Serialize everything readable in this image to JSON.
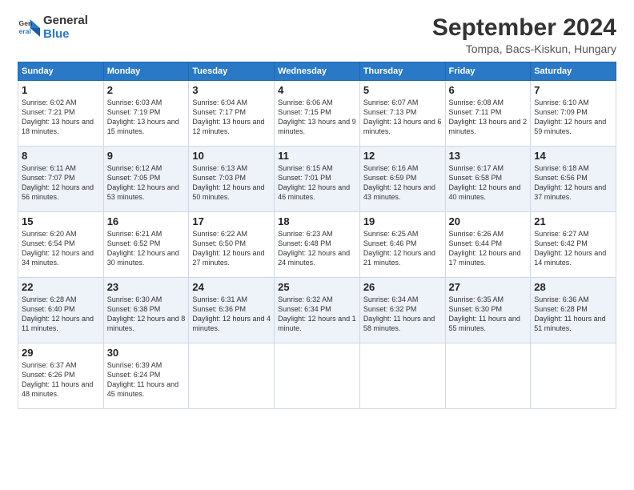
{
  "logo": {
    "line1": "General",
    "line2": "Blue"
  },
  "title": "September 2024",
  "subtitle": "Tompa, Bacs-Kiskun, Hungary",
  "headers": [
    "Sunday",
    "Monday",
    "Tuesday",
    "Wednesday",
    "Thursday",
    "Friday",
    "Saturday"
  ],
  "weeks": [
    [
      {
        "day": "1",
        "info": "Sunrise: 6:02 AM\nSunset: 7:21 PM\nDaylight: 13 hours and 18 minutes."
      },
      {
        "day": "2",
        "info": "Sunrise: 6:03 AM\nSunset: 7:19 PM\nDaylight: 13 hours and 15 minutes."
      },
      {
        "day": "3",
        "info": "Sunrise: 6:04 AM\nSunset: 7:17 PM\nDaylight: 13 hours and 12 minutes."
      },
      {
        "day": "4",
        "info": "Sunrise: 6:06 AM\nSunset: 7:15 PM\nDaylight: 13 hours and 9 minutes."
      },
      {
        "day": "5",
        "info": "Sunrise: 6:07 AM\nSunset: 7:13 PM\nDaylight: 13 hours and 6 minutes."
      },
      {
        "day": "6",
        "info": "Sunrise: 6:08 AM\nSunset: 7:11 PM\nDaylight: 13 hours and 2 minutes."
      },
      {
        "day": "7",
        "info": "Sunrise: 6:10 AM\nSunset: 7:09 PM\nDaylight: 12 hours and 59 minutes."
      }
    ],
    [
      {
        "day": "8",
        "info": "Sunrise: 6:11 AM\nSunset: 7:07 PM\nDaylight: 12 hours and 56 minutes."
      },
      {
        "day": "9",
        "info": "Sunrise: 6:12 AM\nSunset: 7:05 PM\nDaylight: 12 hours and 53 minutes."
      },
      {
        "day": "10",
        "info": "Sunrise: 6:13 AM\nSunset: 7:03 PM\nDaylight: 12 hours and 50 minutes."
      },
      {
        "day": "11",
        "info": "Sunrise: 6:15 AM\nSunset: 7:01 PM\nDaylight: 12 hours and 46 minutes."
      },
      {
        "day": "12",
        "info": "Sunrise: 6:16 AM\nSunset: 6:59 PM\nDaylight: 12 hours and 43 minutes."
      },
      {
        "day": "13",
        "info": "Sunrise: 6:17 AM\nSunset: 6:58 PM\nDaylight: 12 hours and 40 minutes."
      },
      {
        "day": "14",
        "info": "Sunrise: 6:18 AM\nSunset: 6:56 PM\nDaylight: 12 hours and 37 minutes."
      }
    ],
    [
      {
        "day": "15",
        "info": "Sunrise: 6:20 AM\nSunset: 6:54 PM\nDaylight: 12 hours and 34 minutes."
      },
      {
        "day": "16",
        "info": "Sunrise: 6:21 AM\nSunset: 6:52 PM\nDaylight: 12 hours and 30 minutes."
      },
      {
        "day": "17",
        "info": "Sunrise: 6:22 AM\nSunset: 6:50 PM\nDaylight: 12 hours and 27 minutes."
      },
      {
        "day": "18",
        "info": "Sunrise: 6:23 AM\nSunset: 6:48 PM\nDaylight: 12 hours and 24 minutes."
      },
      {
        "day": "19",
        "info": "Sunrise: 6:25 AM\nSunset: 6:46 PM\nDaylight: 12 hours and 21 minutes."
      },
      {
        "day": "20",
        "info": "Sunrise: 6:26 AM\nSunset: 6:44 PM\nDaylight: 12 hours and 17 minutes."
      },
      {
        "day": "21",
        "info": "Sunrise: 6:27 AM\nSunset: 6:42 PM\nDaylight: 12 hours and 14 minutes."
      }
    ],
    [
      {
        "day": "22",
        "info": "Sunrise: 6:28 AM\nSunset: 6:40 PM\nDaylight: 12 hours and 11 minutes."
      },
      {
        "day": "23",
        "info": "Sunrise: 6:30 AM\nSunset: 6:38 PM\nDaylight: 12 hours and 8 minutes."
      },
      {
        "day": "24",
        "info": "Sunrise: 6:31 AM\nSunset: 6:36 PM\nDaylight: 12 hours and 4 minutes."
      },
      {
        "day": "25",
        "info": "Sunrise: 6:32 AM\nSunset: 6:34 PM\nDaylight: 12 hours and 1 minute."
      },
      {
        "day": "26",
        "info": "Sunrise: 6:34 AM\nSunset: 6:32 PM\nDaylight: 11 hours and 58 minutes."
      },
      {
        "day": "27",
        "info": "Sunrise: 6:35 AM\nSunset: 6:30 PM\nDaylight: 11 hours and 55 minutes."
      },
      {
        "day": "28",
        "info": "Sunrise: 6:36 AM\nSunset: 6:28 PM\nDaylight: 11 hours and 51 minutes."
      }
    ],
    [
      {
        "day": "29",
        "info": "Sunrise: 6:37 AM\nSunset: 6:26 PM\nDaylight: 11 hours and 48 minutes."
      },
      {
        "day": "30",
        "info": "Sunrise: 6:39 AM\nSunset: 6:24 PM\nDaylight: 11 hours and 45 minutes."
      },
      {
        "day": "",
        "info": ""
      },
      {
        "day": "",
        "info": ""
      },
      {
        "day": "",
        "info": ""
      },
      {
        "day": "",
        "info": ""
      },
      {
        "day": "",
        "info": ""
      }
    ]
  ]
}
